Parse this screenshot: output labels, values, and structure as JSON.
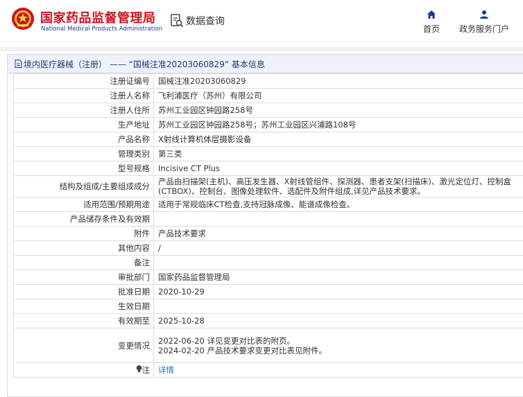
{
  "header": {
    "brand_cn": "国家药品监督管理局",
    "brand_en": "National Medical Products Administration",
    "query_label": "数据查询",
    "nav": [
      {
        "label": "首页",
        "icon": "home-icon"
      },
      {
        "label": "政务服务门户",
        "icon": "user-icon"
      }
    ]
  },
  "panel": {
    "title": "境内医疗器械（注册） —— “国械注准20203060829” 基本信息"
  },
  "rows": [
    {
      "label": "注册证编号",
      "value": "国械注准20203060829"
    },
    {
      "label": "注册人名称",
      "value": "飞利浦医疗（苏州）有限公司"
    },
    {
      "label": "注册人住所",
      "value": "苏州工业园区钟园路258号"
    },
    {
      "label": "生产地址",
      "value": "苏州工业园区钟园路258号；苏州工业园区兴浦路108号"
    },
    {
      "label": "产品名称",
      "value": "X射线计算机体层摄影设备"
    },
    {
      "label": "管理类别",
      "value": "第三类"
    },
    {
      "label": "型号规格",
      "value": "Incisive CT Plus"
    },
    {
      "label": "结构及组成/主要组成成分",
      "value": "产品由扫描架(主机)、高压发生器、X射线管组件、探测器、患者支架(扫描床)、激光定位灯、控制盒(CTBOX)、控制台、图像处理软件、选配件及附件组成,详见产品技术要求。"
    },
    {
      "label": "适用范围/预期用途",
      "value": "适用于常规临床CT检查,支持冠脉成像、能谱成像检查。"
    },
    {
      "label": "产品储存条件及有效期",
      "value": ""
    },
    {
      "label": "附件",
      "value": "产品技术要求"
    },
    {
      "label": "其他内容",
      "value": "/"
    },
    {
      "label": "备注",
      "value": ""
    },
    {
      "label": "审批部门",
      "value": "国家药品监督管理局"
    },
    {
      "label": "批准日期",
      "value": "2020-10-29"
    },
    {
      "label": "生效日期",
      "value": ""
    },
    {
      "label": "有效期至",
      "value": "2025-10-28"
    }
  ],
  "changes": {
    "label": "变更情况",
    "lines": [
      "2022-06-20 详见变更对比表的附页。",
      "2024-02-20 产品技术要求变更对比表见附件。"
    ]
  },
  "note": {
    "label": "注",
    "link": "详情"
  },
  "colors": {
    "brand_red": "#c8161e",
    "brand_blue": "#1a3a8a",
    "link": "#1f6fb5",
    "title_bar": "#eef2f8"
  }
}
